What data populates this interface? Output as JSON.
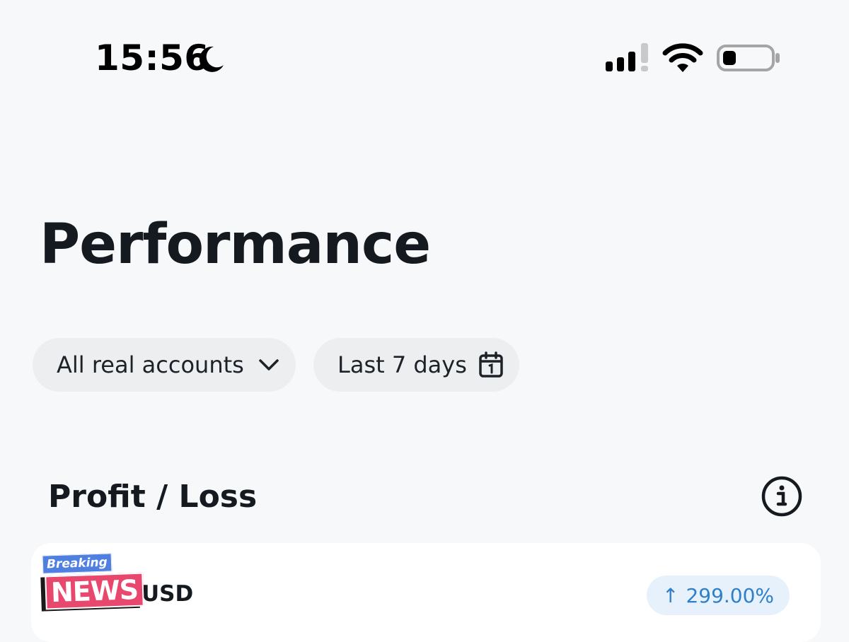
{
  "status_bar": {
    "time": "15:56",
    "focus_mode_icon": "moon-icon",
    "signal_icon": "cellular-signal-icon",
    "wifi_icon": "wifi-icon",
    "battery_icon": "battery-low-icon",
    "battery_level": 0.25
  },
  "page": {
    "title": "Performance"
  },
  "filters": {
    "accounts": {
      "label": "All real accounts",
      "icon": "chevron-down-icon"
    },
    "date_range": {
      "label": "Last 7 days",
      "icon": "calendar-icon"
    }
  },
  "profit_loss": {
    "title": "Profit / Loss",
    "info_icon": "info-icon",
    "card": {
      "currency": "USD",
      "change_arrow": "↑",
      "change_value": "299.00%"
    }
  },
  "overlay": {
    "sticker_top": "Breaking",
    "sticker_main": "NEWS"
  },
  "colors": {
    "background": "#f7f8f9",
    "chip_background": "#eceef0",
    "card_background": "#ffffff",
    "positive_text": "#2f80c8",
    "positive_background": "#e6f1fb",
    "sticker_blue": "#4f7fe0",
    "sticker_pink": "#e8486d"
  }
}
